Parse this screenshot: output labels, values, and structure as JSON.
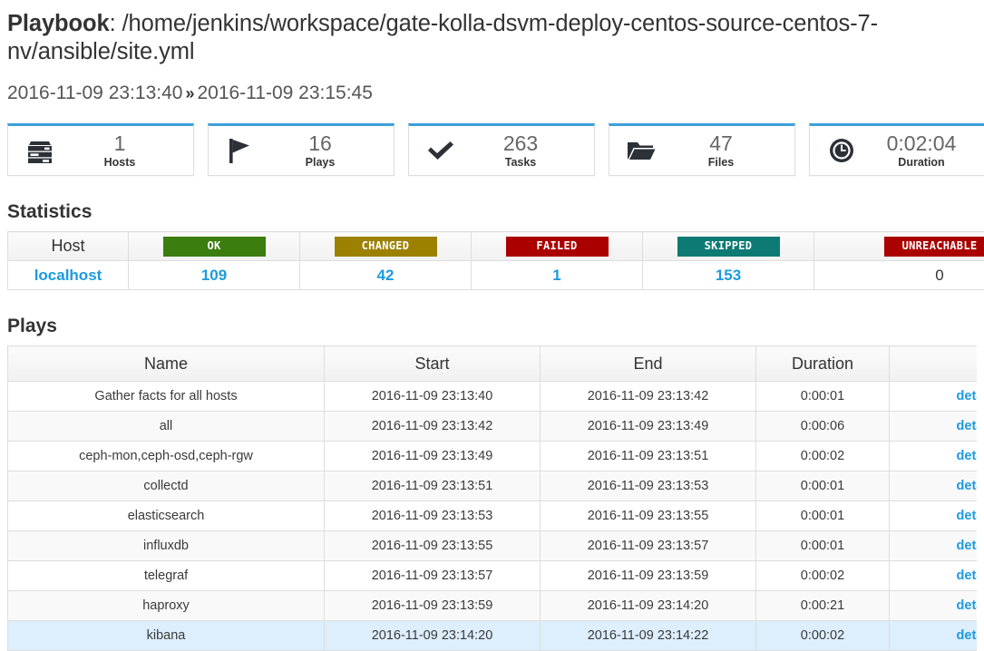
{
  "header": {
    "playbook_label": "Playbook",
    "playbook_sep": ": ",
    "playbook_path": "/home/jenkins/workspace/gate-kolla-dsvm-deploy-centos-source-centos-7-nv/ansible/site.yml",
    "start_time": "2016-11-09 23:13:40",
    "range_separator": "»",
    "end_time": "2016-11-09 23:15:45"
  },
  "cards": [
    {
      "icon": "server-icon",
      "value": "1",
      "label": "Hosts",
      "accent": "#3da0db"
    },
    {
      "icon": "flag-icon",
      "value": "16",
      "label": "Plays",
      "accent": "#3da0db"
    },
    {
      "icon": "check-icon",
      "value": "263",
      "label": "Tasks",
      "accent": "#3da0db"
    },
    {
      "icon": "folder-icon",
      "value": "47",
      "label": "Files",
      "accent": "#3da0db"
    },
    {
      "icon": "clock-icon",
      "value": "0:02:04",
      "label": "Duration",
      "accent": "#3da0db"
    }
  ],
  "statistics": {
    "heading": "Statistics",
    "columns": [
      {
        "key": "host",
        "label": "Host",
        "badge": false,
        "color": ""
      },
      {
        "key": "ok",
        "label": "OK",
        "badge": true,
        "color": "#3b7d0f"
      },
      {
        "key": "changed",
        "label": "CHANGED",
        "badge": true,
        "color": "#9c8100"
      },
      {
        "key": "failed",
        "label": "FAILED",
        "badge": true,
        "color": "#aa0000"
      },
      {
        "key": "skipped",
        "label": "SKIPPED",
        "badge": true,
        "color": "#0d7a73"
      },
      {
        "key": "unreachable",
        "label": "UNREACHABLE",
        "badge": true,
        "color": "#aa0000"
      }
    ],
    "rows": [
      {
        "host": "localhost",
        "ok": "109",
        "changed": "42",
        "failed": "1",
        "skipped": "153",
        "unreachable": "0",
        "unreachable_is_link": false
      }
    ]
  },
  "plays": {
    "heading": "Plays",
    "columns": [
      "Name",
      "Start",
      "End",
      "Duration",
      ""
    ],
    "details_label": "details",
    "rows": [
      {
        "name": "Gather facts for all hosts",
        "start": "2016-11-09 23:13:40",
        "end": "2016-11-09 23:13:42",
        "duration": "0:00:01",
        "details": "details",
        "hover": false
      },
      {
        "name": "all",
        "start": "2016-11-09 23:13:42",
        "end": "2016-11-09 23:13:49",
        "duration": "0:00:06",
        "details": "details",
        "hover": false
      },
      {
        "name": "ceph-mon,ceph-osd,ceph-rgw",
        "start": "2016-11-09 23:13:49",
        "end": "2016-11-09 23:13:51",
        "duration": "0:00:02",
        "details": "details",
        "hover": false
      },
      {
        "name": "collectd",
        "start": "2016-11-09 23:13:51",
        "end": "2016-11-09 23:13:53",
        "duration": "0:00:01",
        "details": "details",
        "hover": false
      },
      {
        "name": "elasticsearch",
        "start": "2016-11-09 23:13:53",
        "end": "2016-11-09 23:13:55",
        "duration": "0:00:01",
        "details": "details",
        "hover": false
      },
      {
        "name": "influxdb",
        "start": "2016-11-09 23:13:55",
        "end": "2016-11-09 23:13:57",
        "duration": "0:00:01",
        "details": "details",
        "hover": false
      },
      {
        "name": "telegraf",
        "start": "2016-11-09 23:13:57",
        "end": "2016-11-09 23:13:59",
        "duration": "0:00:02",
        "details": "details",
        "hover": false
      },
      {
        "name": "haproxy",
        "start": "2016-11-09 23:13:59",
        "end": "2016-11-09 23:14:20",
        "duration": "0:00:21",
        "details": "details",
        "hover": false
      },
      {
        "name": "kibana",
        "start": "2016-11-09 23:14:20",
        "end": "2016-11-09 23:14:22",
        "duration": "0:00:02",
        "details": "details",
        "hover": true
      }
    ]
  }
}
